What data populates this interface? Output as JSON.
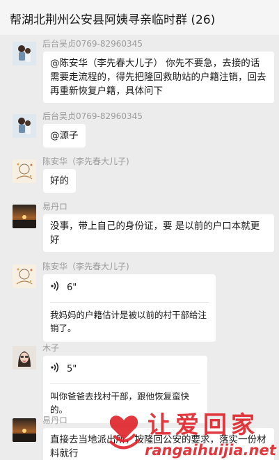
{
  "header": {
    "title": "帮湖北荆州公安县阿姨寻亲临时群 (26)"
  },
  "messages": [
    {
      "sender": "后台吴贞0769-82960345",
      "avatar": "child-avatar",
      "text": "@陈安华（李先春大儿子） 你先不要急，去接的话需要走流程的，得先把隆回救助站的户籍注销，回去再重新恢复户籍，具体问下"
    },
    {
      "sender": "后台吴贞0769-82960345",
      "avatar": "child-avatar",
      "text": "@源子"
    },
    {
      "sender": "陈安华（李先春大儿子)",
      "avatar": "sketch-avatar",
      "text": "好的"
    },
    {
      "sender": "易丹ロ",
      "avatar": "sunset-avatar",
      "text": "没事，带上自己的身份证，要 是以前的户口本就更好"
    },
    {
      "sender": "陈安华（李先春大儿子)",
      "avatar": "sketch-avatar",
      "voice_duration": "6\"",
      "transcript": "我妈妈的户籍估计是被以前的村干部给注销了。"
    },
    {
      "sender": "木子",
      "avatar": "woman-avatar",
      "voice_duration": "5\"",
      "transcript": "叫你爸爸去找村干部，跟他恢复蛮快的。"
    },
    {
      "sender": "易丹ロ",
      "avatar": "sunset-avatar",
      "text": "直接去当地派出所，按隆回公安的要求，落实一份材料就行"
    }
  ],
  "watermark": {
    "text": "让爱回家",
    "url": "rangaihuijia.net"
  },
  "colors": {
    "bg": "#ececec",
    "bubble": "#ffffff",
    "sender": "#9b9b9b",
    "watermark": "#e0222a"
  }
}
